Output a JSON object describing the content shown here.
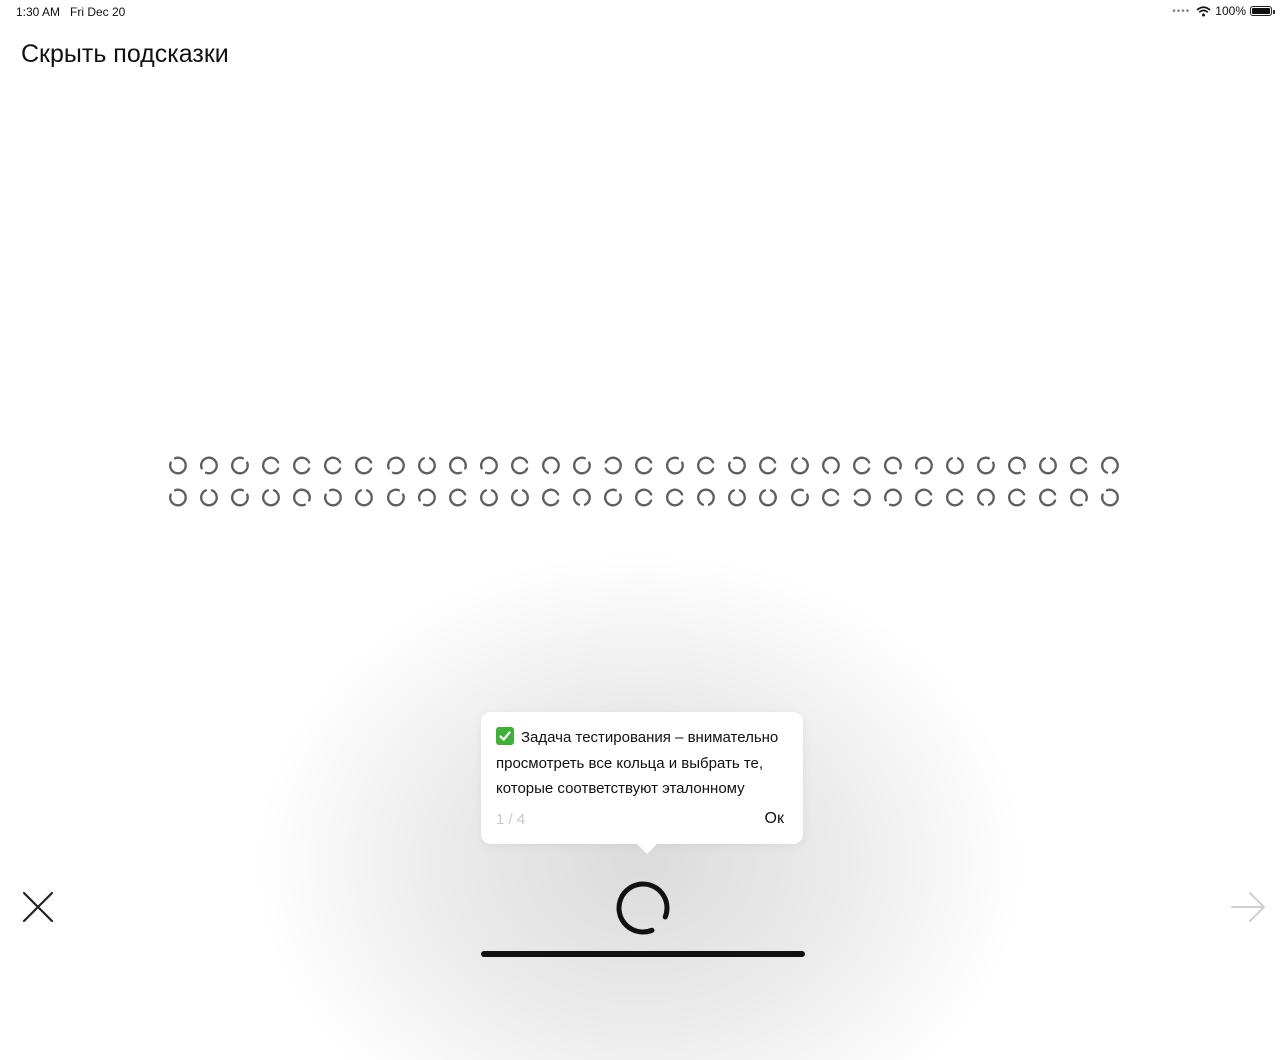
{
  "status_bar": {
    "time": "1:30 AM",
    "date": "Fri Dec 20",
    "battery": "100%",
    "icons": [
      "signal-dots-icon",
      "wifi-icon",
      "battery-icon"
    ]
  },
  "header": {
    "hide_hints_label": "Скрыть подсказки"
  },
  "rings": {
    "color": "#5f5f5f",
    "gap_angles_row1": [
      225,
      135,
      315,
      0,
      0,
      0,
      0,
      135,
      270,
      45,
      135,
      0,
      90,
      315,
      180,
      0,
      315,
      0,
      225,
      0,
      270,
      90,
      0,
      45,
      135,
      270,
      315,
      45,
      270,
      0,
      90
    ],
    "gap_angles_row2": [
      225,
      270,
      315,
      270,
      45,
      225,
      270,
      315,
      135,
      0,
      270,
      270,
      0,
      90,
      315,
      0,
      0,
      90,
      270,
      270,
      315,
      0,
      180,
      135,
      0,
      0,
      90,
      0,
      0,
      45,
      225
    ]
  },
  "tooltip": {
    "check_icon": "check-icon",
    "text_lines": [
      "Задача тестирования – внимательно",
      "просмотреть все кольца и выбрать те,",
      "которые соответствуют эталонному"
    ],
    "counter": "1 / 4",
    "ok_label": "Ок"
  },
  "target_ring": {
    "gap_angle": 45,
    "color": "#111111"
  },
  "controls": {
    "close_icon": "close-icon",
    "next_icon": "arrow-right-icon"
  }
}
